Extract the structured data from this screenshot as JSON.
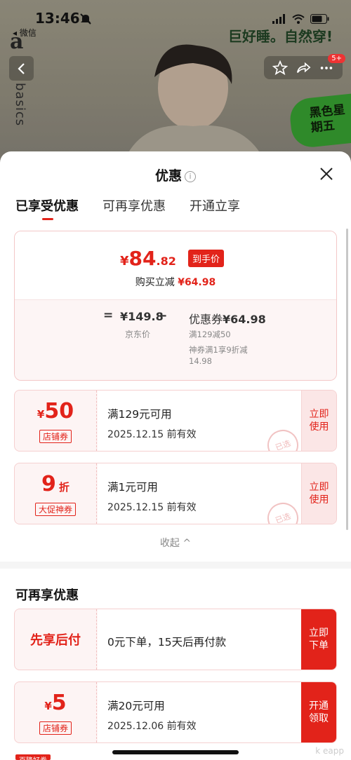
{
  "status_bar": {
    "time": "13:46",
    "back_app": "◂ 微信"
  },
  "background": {
    "brand_letter": "a",
    "brand_vertical": "basics",
    "slogan": "巨好睡。自然穿!",
    "promo_tag": "黑色星期五",
    "cart_badge": "5+"
  },
  "sheet": {
    "title": "优惠",
    "tabs": [
      {
        "label": "已享受优惠",
        "active": true
      },
      {
        "label": "可再享优惠",
        "active": false
      },
      {
        "label": "开通立享",
        "active": false
      }
    ],
    "summary": {
      "yen": "¥",
      "final_int": "84",
      "final_dec": ".82",
      "final_tag": "到手价",
      "instant_cut_label": "购买立减",
      "instant_cut_amount": "¥64.98",
      "eq": "=",
      "original_price": "¥149.8",
      "original_label": "京东价",
      "minus": "–",
      "coupon_label": "优惠券",
      "coupon_amount": "¥64.98",
      "coupon_detail_1": "满129减50",
      "coupon_detail_2": "神券满1享9折减",
      "coupon_detail_3": "14.98"
    },
    "applied_coupons": [
      {
        "prefix": "¥",
        "amount": "50",
        "suffix": "",
        "type": "店铺券",
        "condition": "满129元可用",
        "validity": "2025.12.15 前有效",
        "action": "立即使用",
        "stamp": "已选"
      },
      {
        "prefix": "",
        "amount": "9",
        "suffix": "折",
        "type": "大促神券",
        "condition": "满1元可用",
        "validity": "2025.12.15 前有效",
        "action": "立即使用",
        "stamp": "已选"
      }
    ],
    "collapse_label": "收起 ^",
    "more_section_title": "可再享优惠",
    "more_offers": {
      "paylater": {
        "label": "先享后付",
        "desc": "0元下单，15天后再付款",
        "action": "立即下单"
      },
      "coupon": {
        "prefix": "¥",
        "amount": "5",
        "type": "店铺券",
        "condition": "满20元可用",
        "validity": "2025.12.06 前有效",
        "action": "开通领取"
      }
    },
    "peek_label": "百降好券"
  },
  "watermark": "k eapp",
  "colors": {
    "accent": "#e2231a",
    "card_bg": "#fdf4f4",
    "card_border": "#f5d0d0"
  }
}
